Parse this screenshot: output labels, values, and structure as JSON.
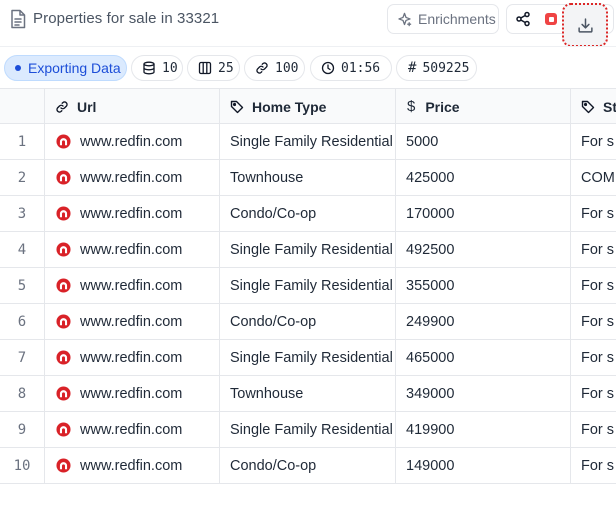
{
  "header": {
    "title": "Properties for sale in 33321",
    "enrichments_label": "Enrichments"
  },
  "status": {
    "exporting_label": "Exporting Data",
    "rows": "10",
    "columns": "25",
    "pages": "100",
    "time": "01:56",
    "id": "509225"
  },
  "colors": {
    "accent": "#1d4ed8",
    "stop": "#ef4444",
    "redfin": "#d92228"
  },
  "table": {
    "columns": [
      "Url",
      "Home Type",
      "Price",
      "St"
    ],
    "rows": [
      {
        "num": "1",
        "url": "www.redfin.com",
        "type": "Single Family Residential",
        "price": "5000",
        "status": "For s"
      },
      {
        "num": "2",
        "url": "www.redfin.com",
        "type": "Townhouse",
        "price": "425000",
        "status": "COM"
      },
      {
        "num": "3",
        "url": "www.redfin.com",
        "type": "Condo/Co-op",
        "price": "170000",
        "status": "For s"
      },
      {
        "num": "4",
        "url": "www.redfin.com",
        "type": "Single Family Residential",
        "price": "492500",
        "status": "For s"
      },
      {
        "num": "5",
        "url": "www.redfin.com",
        "type": "Single Family Residential",
        "price": "355000",
        "status": "For s"
      },
      {
        "num": "6",
        "url": "www.redfin.com",
        "type": "Condo/Co-op",
        "price": "249900",
        "status": "For s"
      },
      {
        "num": "7",
        "url": "www.redfin.com",
        "type": "Single Family Residential",
        "price": "465000",
        "status": "For s"
      },
      {
        "num": "8",
        "url": "www.redfin.com",
        "type": "Townhouse",
        "price": "349000",
        "status": "For s"
      },
      {
        "num": "9",
        "url": "www.redfin.com",
        "type": "Single Family Residential",
        "price": "419900",
        "status": "For s"
      },
      {
        "num": "10",
        "url": "www.redfin.com",
        "type": "Condo/Co-op",
        "price": "149000",
        "status": "For s"
      }
    ]
  }
}
